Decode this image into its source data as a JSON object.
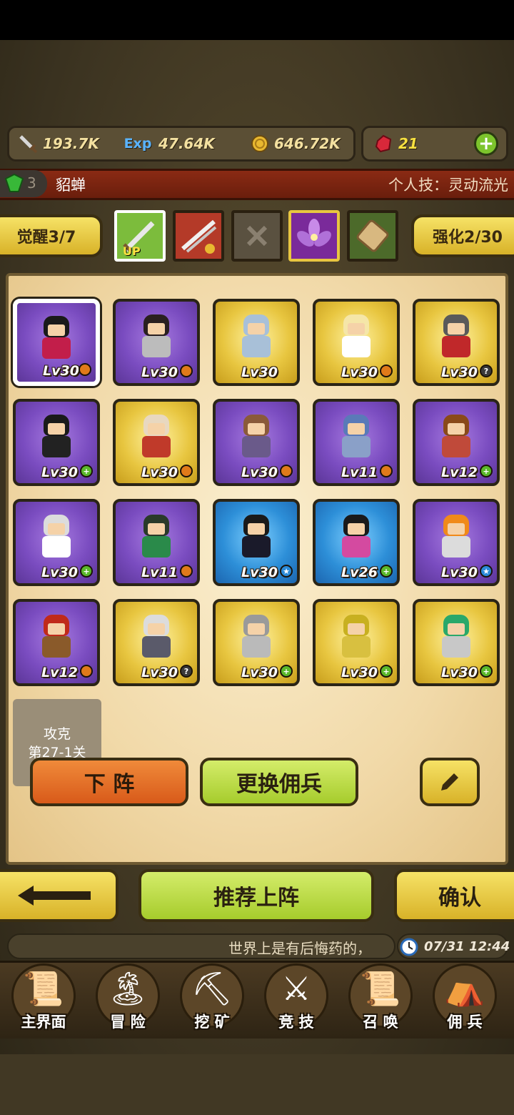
{
  "resources": {
    "attack": {
      "icon": "sword-icon",
      "value": "193.7K"
    },
    "exp": {
      "icon": "exp-icon",
      "label": "Exp",
      "value": "47.64K"
    },
    "gold": {
      "icon": "coin-icon",
      "value": "646.72K"
    },
    "gems": {
      "icon": "ruby-icon",
      "value": "21"
    },
    "add": "+"
  },
  "hero": {
    "gem_count": "3",
    "name": "貂蝉",
    "skill": "个人技：灵动流光"
  },
  "tabs": {
    "awaken": "觉醒3/7",
    "enhance": "强化2/30",
    "equip_up_label": "UP",
    "slots": [
      {
        "icon": "sword-up-icon",
        "color": "#7cbc3c"
      },
      {
        "icon": "blade-handshake-icon",
        "color": "#b43a28"
      },
      {
        "icon": "empty-slot-icon",
        "color": "#5a5140"
      },
      {
        "icon": "purple-flower-icon",
        "color": "#7a2a9a"
      },
      {
        "icon": "scroll-icon",
        "color": "#4c6a2a"
      }
    ]
  },
  "mercenaries": [
    {
      "rarity": "purple",
      "level": "Lv30",
      "badge": "orange",
      "selected": true,
      "hair": "#1a1a1a",
      "body": "#c21e4a"
    },
    {
      "rarity": "purple",
      "level": "Lv30",
      "badge": "orange",
      "hair": "#2a2020",
      "body": "#bcbcbc"
    },
    {
      "rarity": "gold",
      "level": "Lv30",
      "badge": "none",
      "hair": "#a8c0d8",
      "body": "#a8c0d8"
    },
    {
      "rarity": "gold",
      "level": "Lv30",
      "badge": "orange",
      "hair": "#f5e6a8",
      "body": "#ffffff"
    },
    {
      "rarity": "gold",
      "level": "Lv30",
      "badge": "question",
      "hair": "#5a5a5a",
      "body": "#c0282a"
    },
    {
      "rarity": "purple",
      "level": "Lv30",
      "badge": "plus",
      "hair": "#1a1a1a",
      "body": "#222222"
    },
    {
      "rarity": "gold",
      "level": "Lv30",
      "badge": "orange",
      "hair": "#e8d8c0",
      "body": "#c03a2a"
    },
    {
      "rarity": "purple",
      "level": "Lv30",
      "badge": "orange",
      "hair": "#8a5a3a",
      "body": "#6a5a8a"
    },
    {
      "rarity": "purple",
      "level": "Lv11",
      "badge": "orange",
      "hair": "#5a7ab8",
      "body": "#8aa0c8"
    },
    {
      "rarity": "purple",
      "level": "Lv12",
      "badge": "plus",
      "hair": "#8a4a1a",
      "body": "#c04a3a"
    },
    {
      "rarity": "purple",
      "level": "Lv30",
      "badge": "plus",
      "hair": "#dcdcdc",
      "body": "#ffffff"
    },
    {
      "rarity": "purple",
      "level": "Lv11",
      "badge": "orange",
      "hair": "#2a3a2a",
      "body": "#2a8a4a"
    },
    {
      "rarity": "blue",
      "level": "Lv30",
      "badge": "star",
      "hair": "#1a1a1a",
      "body": "#1a1a2a"
    },
    {
      "rarity": "blue",
      "level": "Lv26",
      "badge": "plus",
      "hair": "#1a1a1a",
      "body": "#d44aa0"
    },
    {
      "rarity": "purple",
      "level": "Lv30",
      "badge": "star",
      "hair": "#f08a1a",
      "body": "#dcdcdc"
    },
    {
      "rarity": "purple",
      "level": "Lv12",
      "badge": "orange",
      "hair": "#c02a1a",
      "body": "#8a5a2a"
    },
    {
      "rarity": "gold",
      "level": "Lv30",
      "badge": "question",
      "hair": "#dcdcdc",
      "body": "#5a5a6a"
    },
    {
      "rarity": "gold",
      "level": "Lv30",
      "badge": "plus",
      "hair": "#9a9a9a",
      "body": "#bababa"
    },
    {
      "rarity": "gold",
      "level": "Lv30",
      "badge": "plus",
      "hair": "#c8b020",
      "body": "#d8c040"
    },
    {
      "rarity": "gold",
      "level": "Lv30",
      "badge": "plus",
      "hair": "#2aa86a",
      "body": "#c8c8c8"
    }
  ],
  "stage": {
    "line1": "攻克",
    "line2": "第27-1关"
  },
  "actions": {
    "remove": "下 阵",
    "replace": "更换佣兵",
    "edit_icon": "pencil-icon"
  },
  "bottom_actions": {
    "back_icon": "arrow-left-icon",
    "recommend": "推荐上阵",
    "confirm": "确认"
  },
  "chat": {
    "message": "世界上是有后悔药的，",
    "clock_icon": "clock-icon",
    "time": "07/31 12:44"
  },
  "nav": [
    {
      "label": "主界面",
      "icon": "map-scroll-icon"
    },
    {
      "label": "冒 险",
      "icon": "island-icon"
    },
    {
      "label": "挖 矿",
      "icon": "pickaxe-icon"
    },
    {
      "label": "竞 技",
      "icon": "crossed-swords-icon"
    },
    {
      "label": "召 唤",
      "icon": "summon-scroll-icon"
    },
    {
      "label": "佣 兵",
      "icon": "tent-icon"
    }
  ],
  "colors": {
    "purple_card": "#7a4cc0",
    "gold_card": "#e8c640",
    "blue_card": "#2d8fd8",
    "primary_button": "#b6dc3c",
    "remove_button": "#e06a24"
  }
}
